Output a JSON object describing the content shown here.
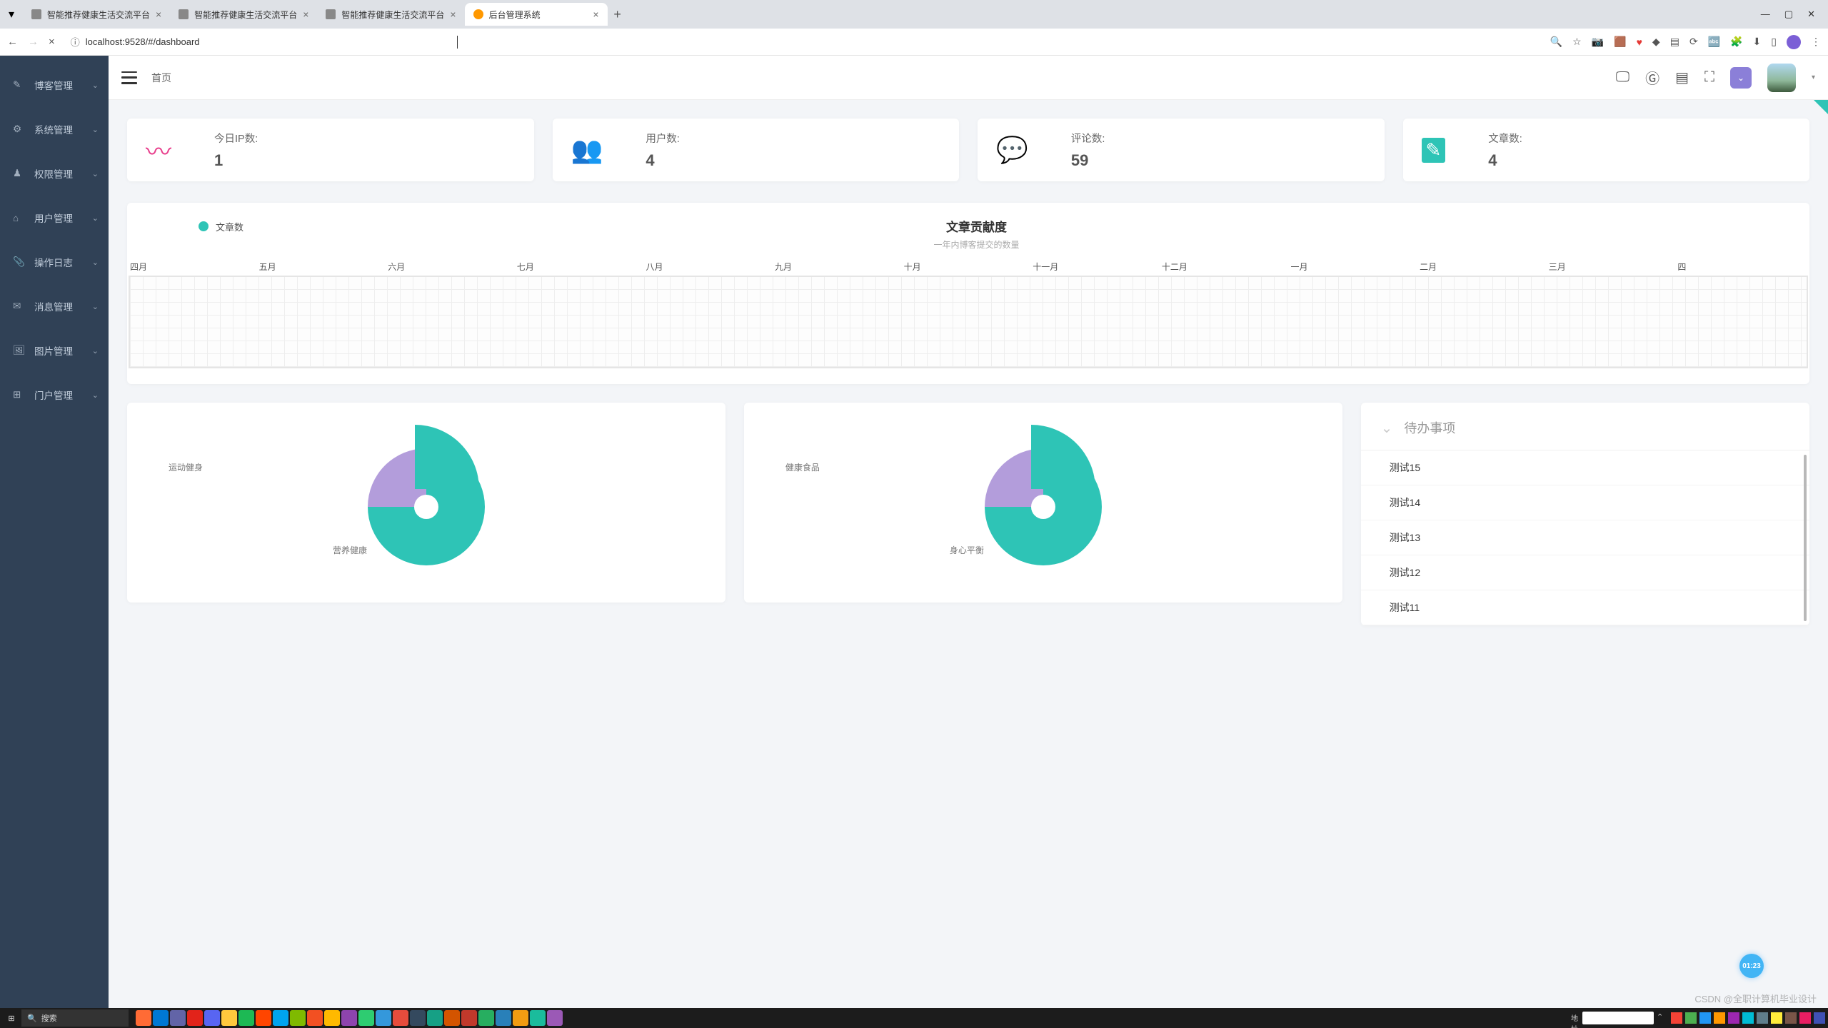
{
  "browser": {
    "tabs": [
      {
        "title": "智能推荐健康生活交流平台"
      },
      {
        "title": "智能推荐健康生活交流平台"
      },
      {
        "title": "智能推荐健康生活交流平台"
      },
      {
        "title": "后台管理系统",
        "active": true
      }
    ],
    "url": "localhost:9528/#/dashboard"
  },
  "sidebar": {
    "items": [
      {
        "icon": "✎",
        "label": "博客管理"
      },
      {
        "icon": "⚙",
        "label": "系统管理"
      },
      {
        "icon": "♟",
        "label": "权限管理"
      },
      {
        "icon": "⌂",
        "label": "用户管理"
      },
      {
        "icon": "📎",
        "label": "操作日志"
      },
      {
        "icon": "✉",
        "label": "消息管理"
      },
      {
        "icon": "🖼",
        "label": "图片管理"
      },
      {
        "icon": "⊞",
        "label": "门户管理"
      }
    ]
  },
  "header": {
    "breadcrumb": "首页"
  },
  "stats": [
    {
      "icon": "〰",
      "color": "#e83e8c",
      "label": "今日IP数:",
      "value": "1"
    },
    {
      "icon": "👥",
      "color": "#2ec4b6",
      "label": "用户数:",
      "value": "4"
    },
    {
      "icon": "💬",
      "color": "#3ea9f5",
      "label": "评论数:",
      "value": "59"
    },
    {
      "icon": "✎",
      "color": "#2ec4b6",
      "label": "文章数:",
      "value": "4"
    }
  ],
  "contribution": {
    "legend": "文章数",
    "title": "文章贡献度",
    "subtitle": "一年内博客提交的数量",
    "months": [
      "四月",
      "五月",
      "六月",
      "七月",
      "八月",
      "九月",
      "十月",
      "十一月",
      "十二月",
      "一月",
      "二月",
      "三月",
      "四"
    ]
  },
  "pies": [
    {
      "label_small": "运动健身",
      "label_big": "营养健康"
    },
    {
      "label_small": "健康食品",
      "label_big": "身心平衡"
    }
  ],
  "todo": {
    "title": "待办事项",
    "items": [
      "测试15",
      "测试14",
      "测试13",
      "测试12",
      "测试11"
    ]
  },
  "float_time": "01:23",
  "taskbar": {
    "search_placeholder": "搜索",
    "tray_label": "地址",
    "time": ""
  },
  "watermark": "CSDN @全职计算机毕业设计",
  "chart_data": [
    {
      "type": "heatmap",
      "title": "文章贡献度",
      "subtitle": "一年内博客提交的数量",
      "x_categories": [
        "四月",
        "五月",
        "六月",
        "七月",
        "八月",
        "九月",
        "十月",
        "十一月",
        "十二月",
        "一月",
        "二月",
        "三月",
        "四月"
      ],
      "legend": [
        "文章数"
      ],
      "note": "calendar heatmap grid, no filled cells visible"
    },
    {
      "type": "pie",
      "title": "",
      "series": [
        {
          "name": "营养健康",
          "value": 75
        },
        {
          "name": "运动健身",
          "value": 25
        }
      ],
      "colors": [
        "#2ec4b6",
        "#b39ddb"
      ]
    },
    {
      "type": "pie",
      "title": "",
      "series": [
        {
          "name": "身心平衡",
          "value": 75
        },
        {
          "name": "健康食品",
          "value": 25
        }
      ],
      "colors": [
        "#2ec4b6",
        "#b39ddb"
      ]
    }
  ]
}
